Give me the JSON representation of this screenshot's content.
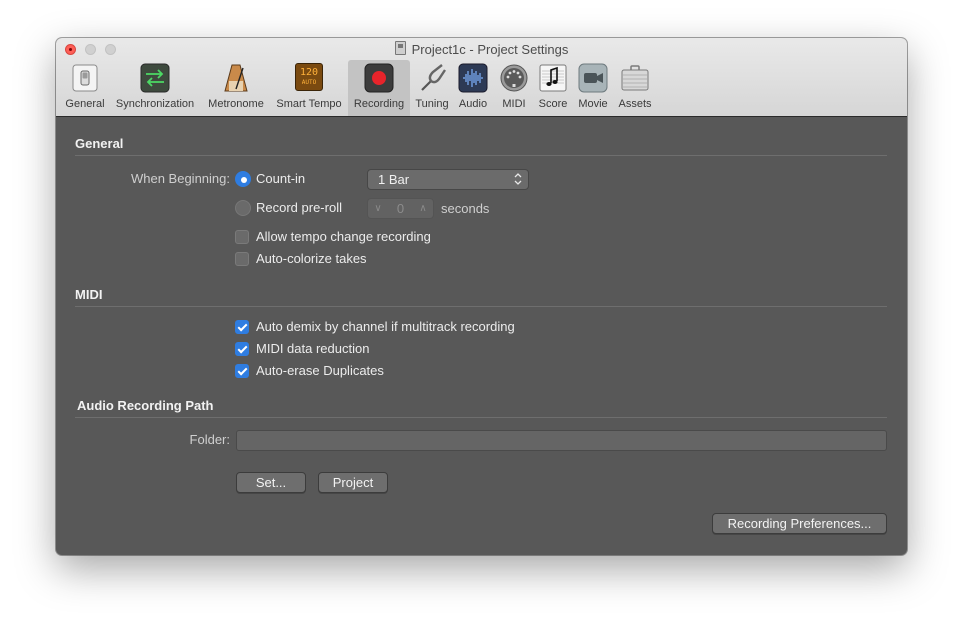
{
  "window": {
    "title": "Project1c - Project Settings"
  },
  "toolbar": {
    "items": [
      {
        "label": "General",
        "icon": "switch-icon"
      },
      {
        "label": "Synchronization",
        "icon": "sync-arrows-icon"
      },
      {
        "label": "Metronome",
        "icon": "metronome-icon"
      },
      {
        "label": "Smart Tempo",
        "icon": "smart-tempo-icon",
        "icon_text_top": "120",
        "icon_text_bottom": "AUTO"
      },
      {
        "label": "Recording",
        "icon": "record-icon",
        "active": true
      },
      {
        "label": "Tuning",
        "icon": "tuning-fork-icon"
      },
      {
        "label": "Audio",
        "icon": "audio-waveform-icon"
      },
      {
        "label": "MIDI",
        "icon": "midi-connector-icon"
      },
      {
        "label": "Score",
        "icon": "score-icon"
      },
      {
        "label": "Movie",
        "icon": "movie-camera-icon"
      },
      {
        "label": "Assets",
        "icon": "briefcase-icon"
      }
    ]
  },
  "general": {
    "heading": "General",
    "when_beginning_label": "When Beginning:",
    "count_in": {
      "label": "Count-in",
      "selected": true
    },
    "count_in_value": "1 Bar",
    "pre_roll": {
      "label": "Record pre-roll",
      "selected": false
    },
    "pre_roll_value": "0",
    "pre_roll_unit": "seconds",
    "allow_tempo": {
      "label": "Allow tempo change recording",
      "checked": false
    },
    "auto_colorize": {
      "label": "Auto-colorize takes",
      "checked": false
    }
  },
  "midi": {
    "heading": "MIDI",
    "auto_demix": {
      "label": "Auto demix by channel if multitrack recording",
      "checked": true
    },
    "data_reduction": {
      "label": "MIDI data reduction",
      "checked": true
    },
    "auto_erase": {
      "label": "Auto-erase Duplicates",
      "checked": true
    }
  },
  "audio_path": {
    "heading": "Audio Recording Path",
    "folder_label": "Folder:",
    "folder_value": "",
    "set_button": "Set...",
    "project_button": "Project"
  },
  "footer": {
    "preferences_button": "Recording Preferences..."
  },
  "colors": {
    "accent": "#2f7de1",
    "record_red": "#e8242b",
    "panel_bg": "#585858"
  }
}
